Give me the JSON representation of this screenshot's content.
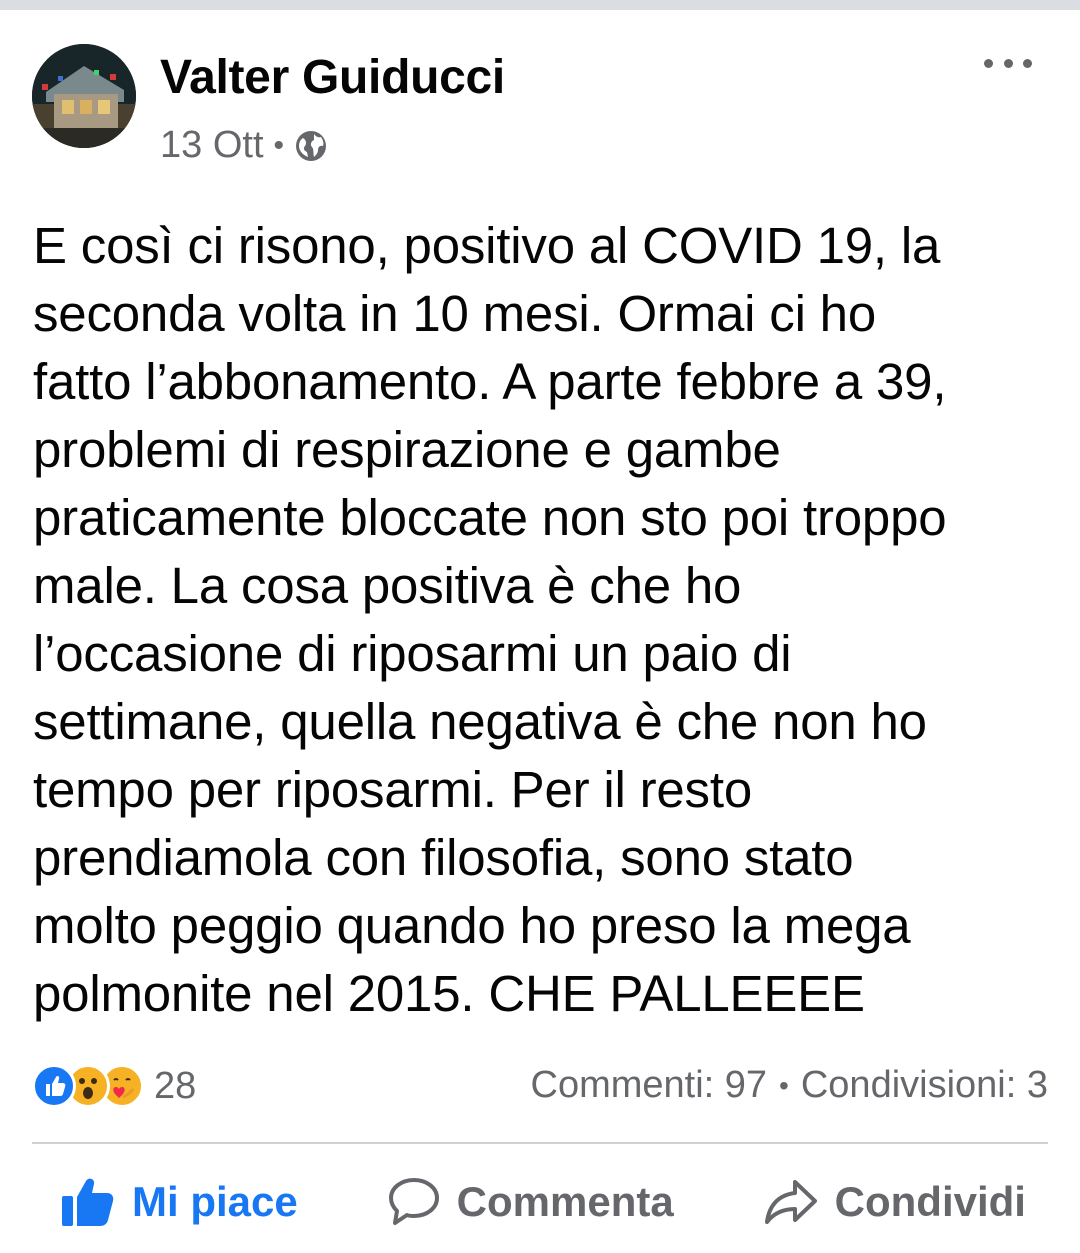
{
  "post": {
    "author": "Valter Guiducci",
    "date": "13 Ott",
    "privacy_icon": "globe-icon",
    "text": "E così ci risono, positivo al COVID 19, la\nseconda volta in 10 mesi. Ormai ci ho\nfatto l’abbonamento. A parte febbre a 39,\nproblemi di respirazione e gambe\npraticamente bloccate non sto poi troppo\nmale. La cosa positiva è che ho\nl’occasione di riposarmi un paio di\nsettimane, quella negativa è che non ho\ntempo per riposarmi. Per il resto\nprendiamola con filosofia, sono stato\nmolto peggio quando ho preso la mega\npolmonite nel 2015. CHE PALLEEEE"
  },
  "stats": {
    "reaction_icons": [
      "like-icon",
      "wow-icon",
      "care-icon"
    ],
    "reactions_count": "28",
    "comments": "Commenti: 97",
    "separator": "•",
    "shares": "Condivisioni: 3"
  },
  "actions": {
    "like_label": "Mi piace",
    "comment_label": "Commenta",
    "share_label": "Condividi"
  },
  "colors": {
    "accent": "#1877f2",
    "secondary_text": "#65676b",
    "primary_text": "#050505",
    "divider": "#ced0d4"
  }
}
